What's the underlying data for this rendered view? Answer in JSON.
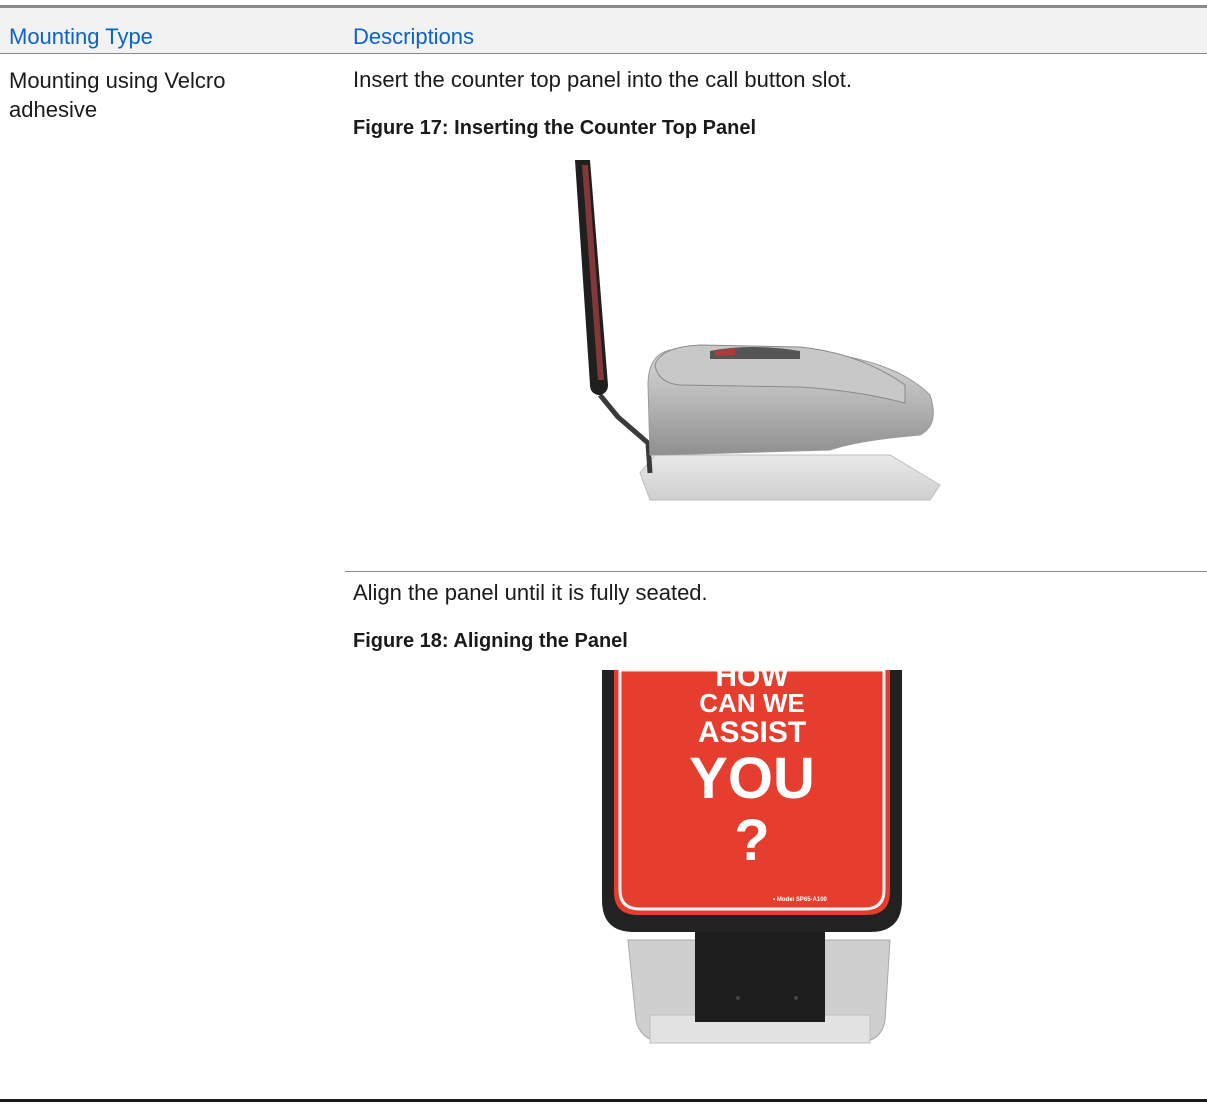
{
  "table": {
    "headers": {
      "col1": "Mounting Type",
      "col2": "Descriptions"
    },
    "row": {
      "mounting_type": "Mounting using Velcro adhesive",
      "steps": [
        {
          "text": "Insert the counter top panel into the call button slot.",
          "figure_caption": "Figure 17: Inserting the Counter Top Panel"
        },
        {
          "text": "Align the panel until it is fully seated.",
          "figure_caption": "Figure 18: Aligning the Panel",
          "panel_sign": {
            "line1": "HOW",
            "line2": "CAN WE",
            "line3": "ASSIST",
            "line4": "YOU",
            "line5": "?",
            "model": "• Model SP65-A100"
          }
        }
      ]
    }
  },
  "colors": {
    "header_text": "#0b63c6",
    "panel_red": "#e53d2e"
  }
}
